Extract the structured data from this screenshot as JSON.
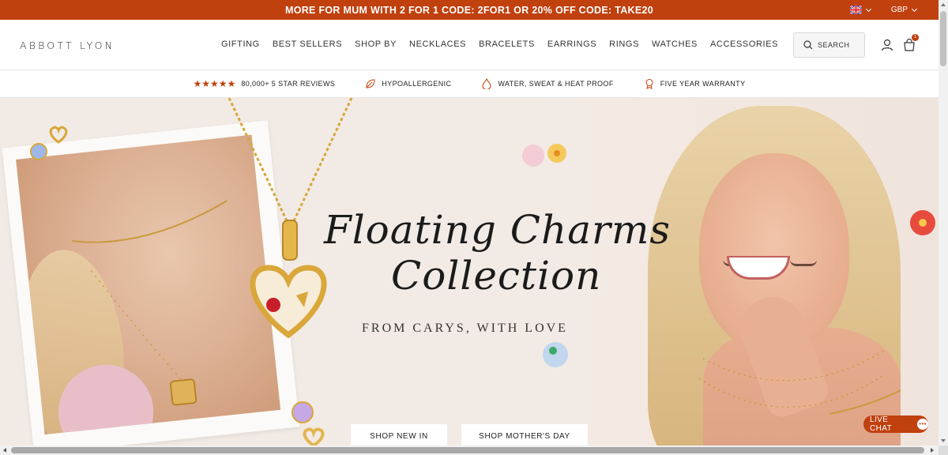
{
  "promo": {
    "text": "MORE FOR MUM WITH 2 FOR 1 CODE: 2FOR1 OR 20% OFF CODE: TAKE20",
    "currency": "GBP",
    "flag_icon": "uk-flag-icon"
  },
  "header": {
    "logo": "ABBOTT LYON",
    "nav": [
      "GIFTING",
      "BEST SELLERS",
      "SHOP BY",
      "NECKLACES",
      "BRACELETS",
      "EARRINGS",
      "RINGS",
      "WATCHES",
      "ACCESSORIES"
    ],
    "search_label": "SEARCH",
    "cart_count": "1"
  },
  "usp": {
    "reviews": "80,000+ 5 STAR REVIEWS",
    "stars": "★★★★★",
    "hypoallergenic": "HYPOALLERGENIC",
    "waterproof": "WATER, SWEAT & HEAT PROOF",
    "warranty": "FIVE YEAR WARRANTY"
  },
  "hero": {
    "title_line1": "Floating Charms",
    "title_line2": "Collection",
    "subtitle": "FROM CARYS, WITH LOVE",
    "button_new_in": "SHOP NEW IN",
    "button_mothers_day": "SHOP MOTHER'S DAY"
  },
  "chat": {
    "label": "LIVE CHAT",
    "icon": "chat-bubble-icon"
  },
  "colors": {
    "accent": "#c0400e",
    "hero_bg": "#f2ebe5"
  }
}
